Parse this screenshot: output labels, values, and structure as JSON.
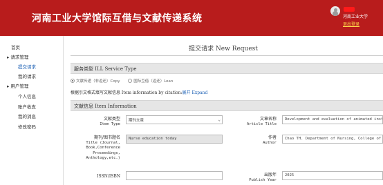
{
  "header": {
    "title": "河南工业大学馆际互借与文献传递系统",
    "user_org": "河南工业大学",
    "logout_label": "退出登录",
    "brand_color": "#b81c1c"
  },
  "sidebar": {
    "home": "首页",
    "requests_section": "请求管理",
    "submit_request": "提交请求",
    "my_requests": "我的请求",
    "user_section": "用户管理",
    "personal_info": "个人信息",
    "account_charges": "账户收支",
    "my_messages": "我的消息",
    "change_password": "修改密码"
  },
  "main": {
    "page_title": "提交请求 New Request",
    "service_section": "服务类型 ILL Service Type",
    "service_options": {
      "copy": "文献传递（非返还）Copy",
      "loan": "国际互借（返还）Loan"
    },
    "cite_text": "根据引文格式填写文献信息 Item information by citation:",
    "expand_label": "展开 Expand",
    "item_section": "文献信息 Item Information",
    "fields": {
      "item_type_label": "文献类型",
      "item_type_label_en": "Item Type",
      "item_type_value": "期刊文章",
      "article_title_label": "文章名称",
      "article_title_label_en": "Article Title",
      "article_title_value": "Development and evaluation of animated instr",
      "journal_title_label": "期刊/图书题名",
      "journal_title_label_en1": "Title (Journal,",
      "journal_title_label_en2": "Book,Conference",
      "journal_title_label_en3": "Proceedings,",
      "journal_title_label_en4": "Anthology,etc.)",
      "journal_title_value": "Nurse education today",
      "author_label": "作者",
      "author_label_en": "Author",
      "author_value": "Chao TH. Department of Nursing, College of",
      "issn_label": "ISSN/ISBN",
      "issn_value": "",
      "year_label": "出版年",
      "year_label_en": "Publish Year",
      "year_value": "2025"
    }
  }
}
